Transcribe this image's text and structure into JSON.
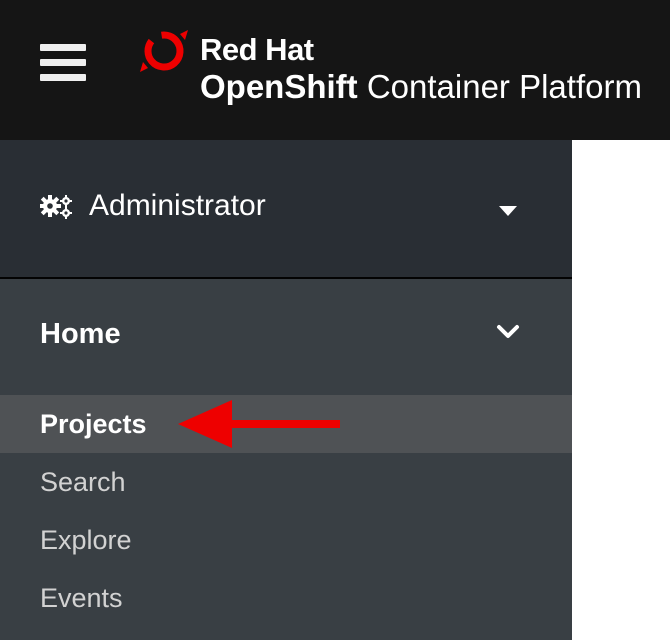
{
  "masthead": {
    "brand_line1": "Red Hat",
    "brand_product_bold": "OpenShift",
    "brand_product_rest": " Container Platform",
    "logo_icon": "redhat-logo-icon",
    "menu_icon": "hamburger-menu-icon"
  },
  "perspective": {
    "label": "Administrator",
    "icon": "cogs-icon",
    "toggle_icon": "caret-down-icon"
  },
  "nav": {
    "section": {
      "label": "Home",
      "icon": "chevron-down-icon",
      "expanded": true
    },
    "items": [
      {
        "label": "Projects",
        "active": true
      },
      {
        "label": "Search",
        "active": false
      },
      {
        "label": "Explore",
        "active": false
      },
      {
        "label": "Events",
        "active": false
      }
    ]
  },
  "annotation": {
    "type": "arrow",
    "color": "#ee0000",
    "points_to": "Projects"
  },
  "colors": {
    "masthead_bg": "#151515",
    "sidebar_bg": "#393f44",
    "perspective_bg": "#292e34",
    "active_item_bg": "#4f5255",
    "redhat_red": "#ee0000"
  }
}
